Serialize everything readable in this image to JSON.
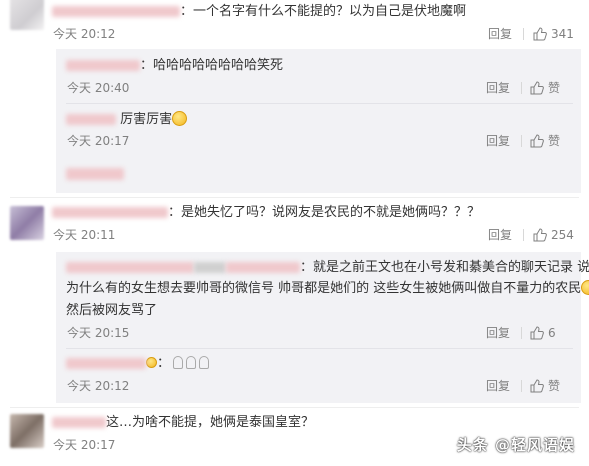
{
  "comments": [
    {
      "text": "：一个名字有什么不能提的？以为自己是伏地魔啊",
      "time": "今天 20:12",
      "reply_label": "回复",
      "like_count": "341",
      "replies": [
        {
          "text": "：哈哈哈哈哈哈哈哈笑死",
          "time": "今天 20:40",
          "reply_label": "回复",
          "like_label": "赞"
        },
        {
          "text": "厉害厉害",
          "emoji": "thinking-face",
          "time": "今天 20:17",
          "reply_label": "回复",
          "like_label": "赞"
        }
      ]
    },
    {
      "text": "：是她失忆了吗？说网友是农民的不就是她俩吗？？？",
      "time": "今天 20:11",
      "reply_label": "回复",
      "like_count": "254",
      "replies": [
        {
          "line1": "：就是之前王文也在小号发和綦美合的聊天记录 说",
          "line2": "为什么有的女生想去要帅哥的微信号 帅哥都是她们的 这些女生被她俩叫做自不量力的农民",
          "line3": "然后被网友骂了",
          "time": "今天 20:15",
          "reply_label": "回复",
          "like_count": "6"
        },
        {
          "text": "：",
          "time": "今天 20:12",
          "reply_label": "回复",
          "like_label": "赞"
        }
      ]
    },
    {
      "text": "这…为啥不能提，她俩是泰国皇室？",
      "time": "今天 20:17"
    }
  ],
  "watermark": "头条 @轻风语娱",
  "colors": {
    "meta": "#808080",
    "reply_bg": "#f2f2f5",
    "redacted_name": "#f0c8cc"
  }
}
